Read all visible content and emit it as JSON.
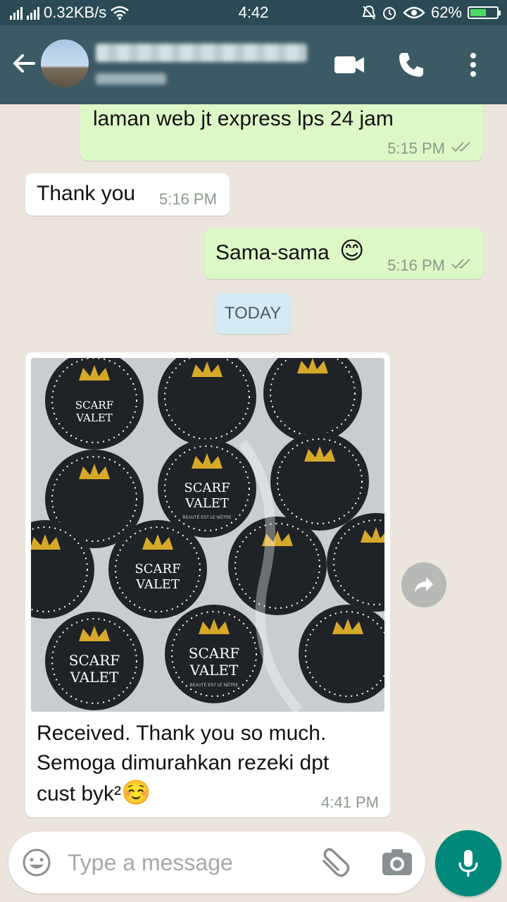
{
  "statusbar": {
    "network_speed": "0.32KB/s",
    "time": "4:42",
    "battery_percent": "62%",
    "battery_level": 0.62
  },
  "header": {
    "icons": [
      "back-arrow-icon",
      "video-call-icon",
      "phone-icon",
      "more-vert-icon"
    ]
  },
  "messages": [
    {
      "direction": "out",
      "text": "laman web jt express lps 24 jam",
      "time": "5:15 PM",
      "status": "read"
    },
    {
      "direction": "in",
      "text": "Thank you",
      "time": "5:16 PM"
    },
    {
      "direction": "out",
      "text": "Sama-sama",
      "emoji": "😊",
      "time": "5:16 PM",
      "status": "read"
    },
    {
      "direction": "in",
      "type": "image",
      "caption_line1": "Received. Thank you so much.",
      "caption_line2": "Semoga dimurahkan rezeki dpt",
      "caption_line3": "cust byk²",
      "emoji": "☺️",
      "time": "4:41 PM",
      "photo_labels": {
        "brand_line1": "SCARF",
        "brand_line2": "VALET",
        "tagline": "BEAUTÉ EST LE NÔTRE"
      }
    }
  ],
  "date_divider": "TODAY",
  "composer": {
    "placeholder": "Type a message"
  },
  "colors": {
    "header": "#3c5a66",
    "statusbar": "#2b4a55",
    "outgoing_bubble": "#dcf8c6",
    "incoming_bubble": "#ffffff",
    "chat_bg": "#ece5dd",
    "mic_button": "#00897b",
    "read_ticks": "#8fa08f"
  }
}
